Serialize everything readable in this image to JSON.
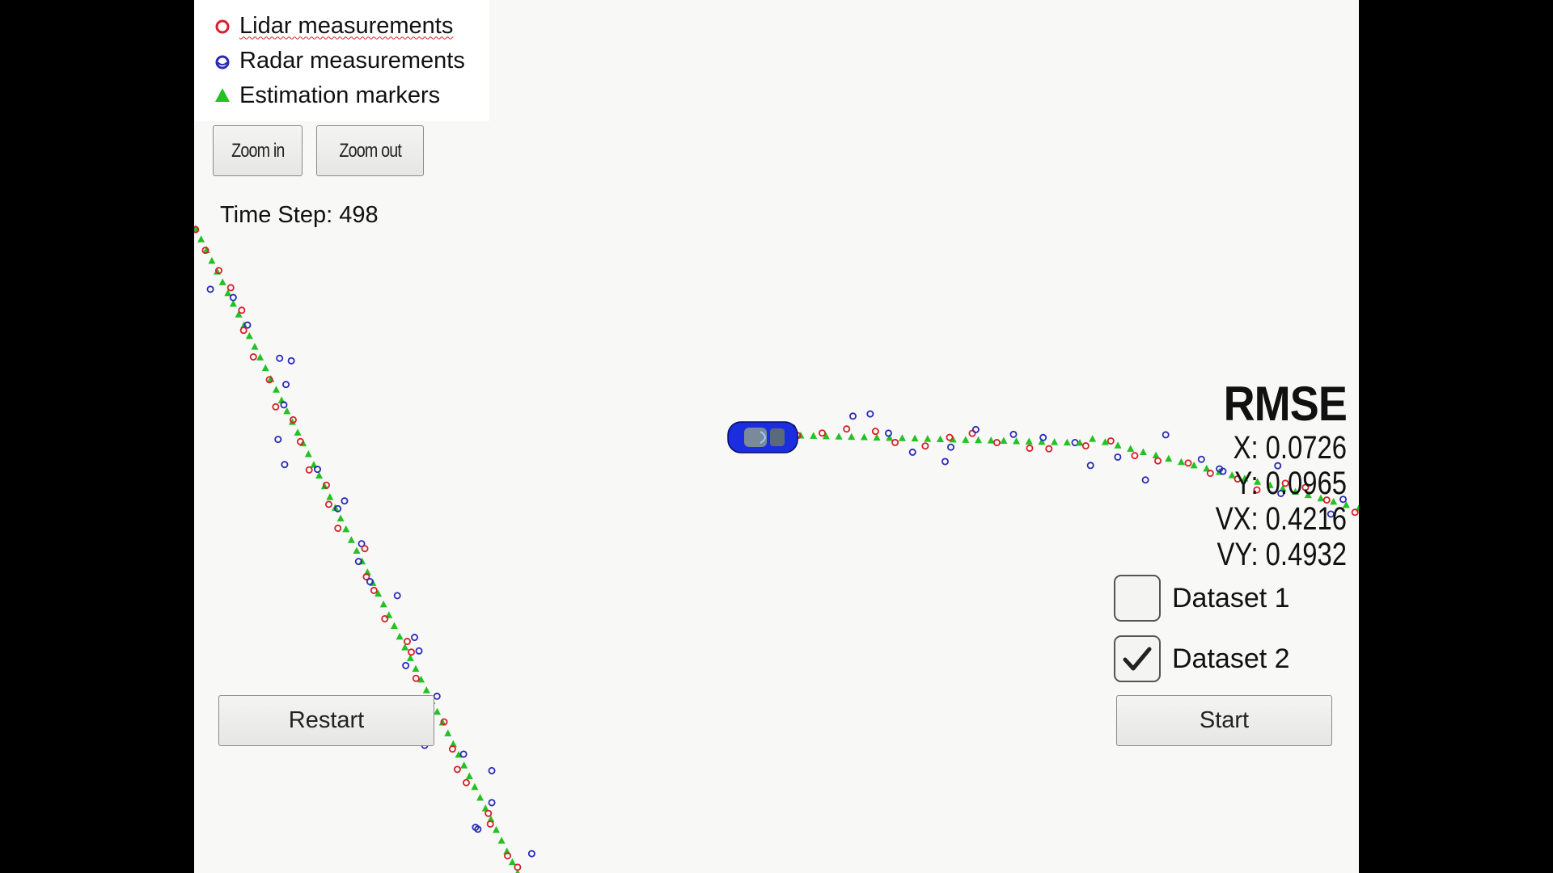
{
  "legend": {
    "lidar_label": "Lidar measurements",
    "radar_label": "Radar measurements",
    "estimation_label": "Estimation markers",
    "lidar_color": "#d6202a",
    "radar_color": "#2a2ab8",
    "estimation_color": "#22c222"
  },
  "toolbar": {
    "zoom_in_label": "Zoom in",
    "zoom_out_label": "Zoom out"
  },
  "status": {
    "time_step_label": "Time Step: 498"
  },
  "rmse": {
    "title": "RMSE",
    "x": "X: 0.0726",
    "y": "Y: 0.0965",
    "vx": "VX: 0.4216",
    "vy": "VY: 0.4932"
  },
  "datasets": [
    {
      "label": "Dataset 1",
      "checked": false
    },
    {
      "label": "Dataset 2",
      "checked": true
    }
  ],
  "controls": {
    "restart_label": "Restart",
    "start_label": "Start"
  },
  "car": {
    "color": "#1a2ee0",
    "icon": "car-icon"
  }
}
